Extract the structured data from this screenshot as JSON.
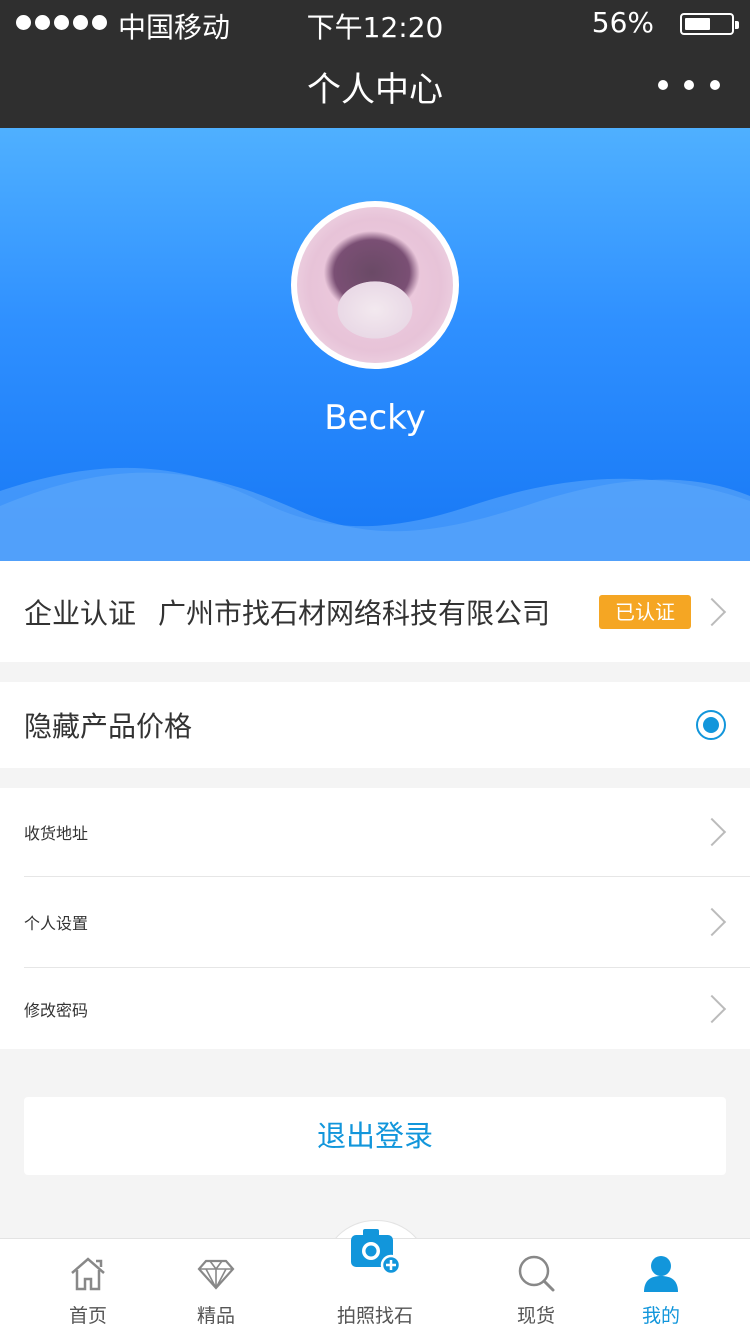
{
  "status_bar": {
    "carrier": "中国移动",
    "time": "下午12:20",
    "battery_percent": "56%",
    "battery_level": 0.56
  },
  "nav": {
    "title": "个人中心",
    "more_icon": "more-dots-icon"
  },
  "profile": {
    "username": "Becky",
    "avatar_icon": "avatar-photo"
  },
  "enterprise": {
    "label": "企业认证",
    "company": "广州市找石材网络科技有限公司",
    "badge": "已认证"
  },
  "hide_price": {
    "label": "隐藏产品价格",
    "selected": true
  },
  "menu": [
    {
      "label": "收货地址"
    },
    {
      "label": "个人设置"
    },
    {
      "label": "修改密码"
    }
  ],
  "logout_label": "退出登录",
  "tabs": [
    {
      "label": "首页",
      "icon": "home-icon"
    },
    {
      "label": "精品",
      "icon": "diamond-icon"
    },
    {
      "label": "拍照找石",
      "icon": "camera-add-icon"
    },
    {
      "label": "现货",
      "icon": "search-icon"
    },
    {
      "label": "我的",
      "icon": "user-icon",
      "active": true
    }
  ],
  "colors": {
    "accent": "#1296db",
    "badge": "#f5a623",
    "header_top": "#4fb0ff",
    "header_bottom": "#1677f5",
    "nav_bg": "#2f2f2f"
  }
}
